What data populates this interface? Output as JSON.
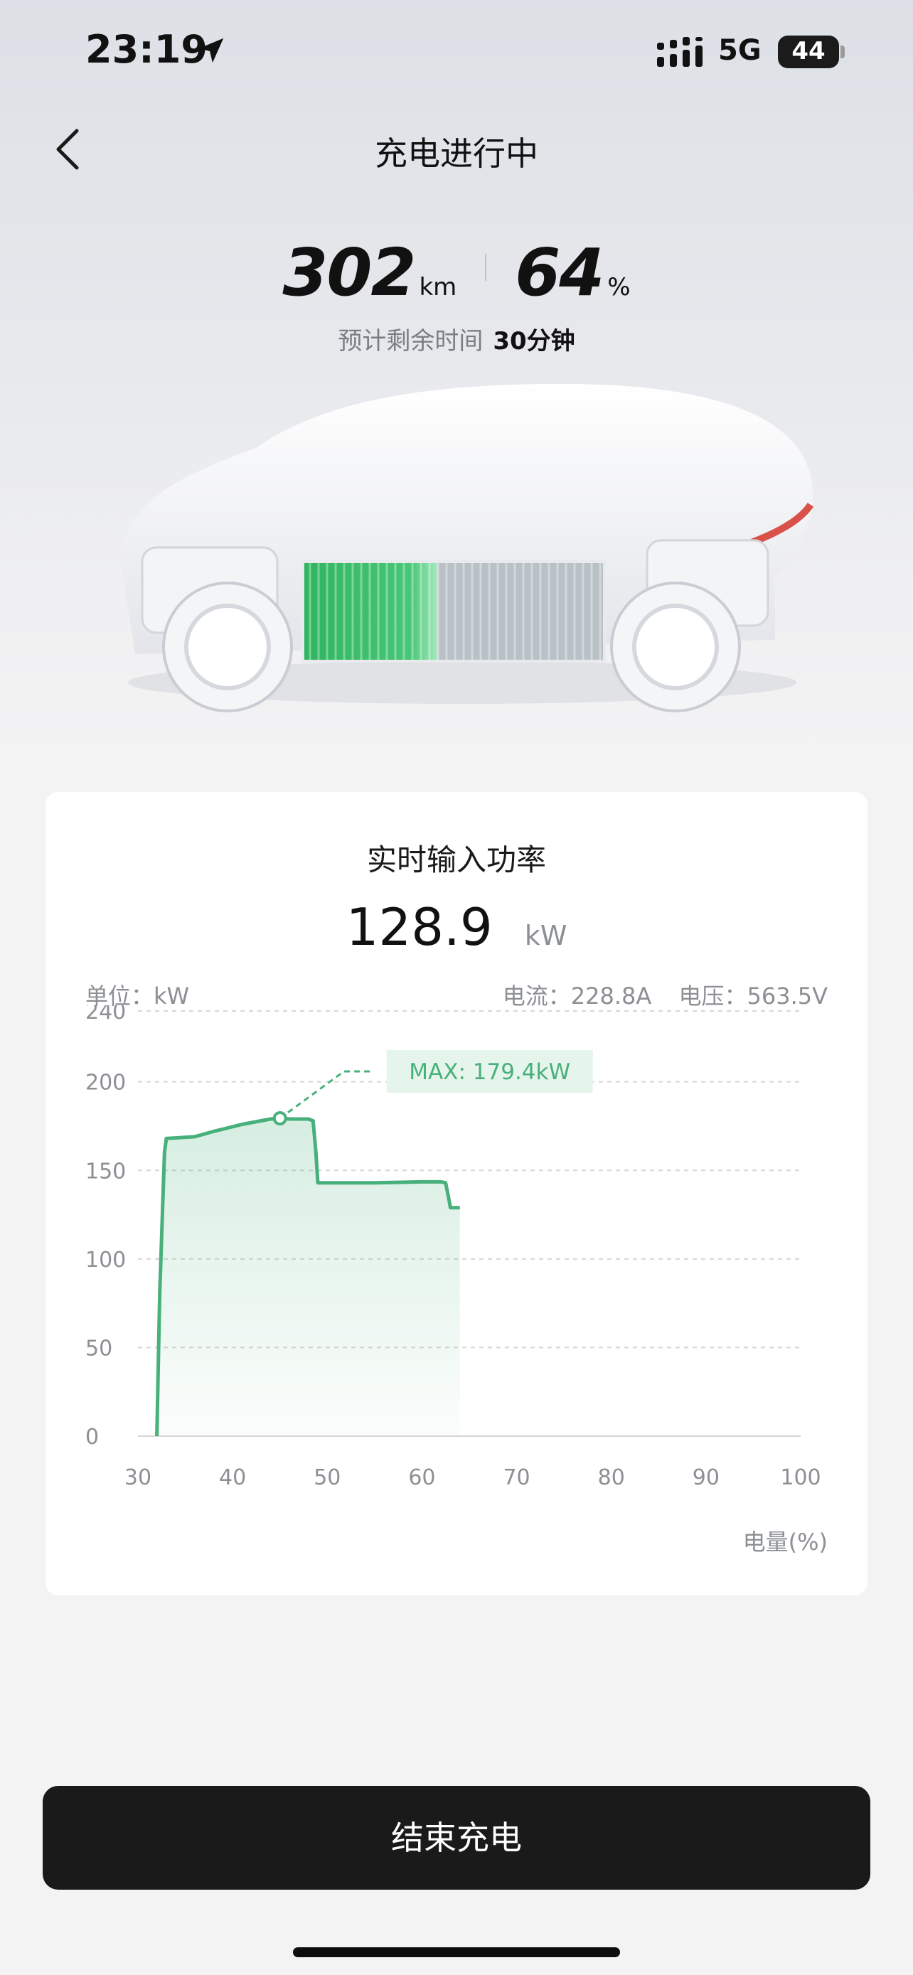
{
  "status_bar": {
    "time": "23:19",
    "network": "5G",
    "battery_level": "44",
    "icons": [
      "location-arrow-icon",
      "cellular-signal-icon",
      "battery-icon"
    ]
  },
  "header": {
    "title": "充电进行中",
    "back_icon": "chevron-left-icon"
  },
  "stats": {
    "range_value": "302",
    "range_unit": "km",
    "soc_value": "64",
    "soc_unit": "%",
    "remaining_label": "预计剩余时间",
    "remaining_value": "30分钟"
  },
  "battery_visual": {
    "charged_fraction": 0.64
  },
  "card": {
    "title": "实时输入功率",
    "power_value": "128.9",
    "power_unit": "kW",
    "unit_label": "单位：kW",
    "current": "电流：228.8A",
    "voltage": "电压：563.5V",
    "axis_title": "电量(%)"
  },
  "chart_data": {
    "type": "area",
    "xlabel": "电量(%)",
    "ylabel": "单位：kW",
    "x_ticks": [
      "30",
      "40",
      "50",
      "60",
      "70",
      "80",
      "90",
      "100"
    ],
    "y_ticks": [
      "0",
      "50",
      "100",
      "150",
      "200",
      "240"
    ],
    "xlim": [
      30,
      100
    ],
    "ylim": [
      0,
      240
    ],
    "grid": true,
    "series": [
      {
        "x": [
          32,
          32.3,
          32.8,
          33,
          36,
          38,
          41,
          43,
          44,
          45,
          46,
          47,
          48,
          48.5,
          48.8,
          49,
          50,
          55,
          60,
          62,
          62.5,
          62.8,
          63,
          64
        ],
        "values": [
          0,
          80,
          160,
          168,
          169,
          172,
          176,
          178,
          179,
          179.4,
          179,
          179,
          179,
          178,
          160,
          143,
          143,
          143,
          143.5,
          143.5,
          143,
          135,
          129,
          128.9
        ]
      }
    ],
    "max_annotation": {
      "x": 45,
      "y": 179.4,
      "label": "MAX: 179.4kW"
    },
    "colors": {
      "line": "#48b07a",
      "fill": "#48b07a",
      "grid": "#d6d6d6",
      "label_bg": "#e6f5ec"
    }
  },
  "actions": {
    "end_charging": "结束充电"
  }
}
